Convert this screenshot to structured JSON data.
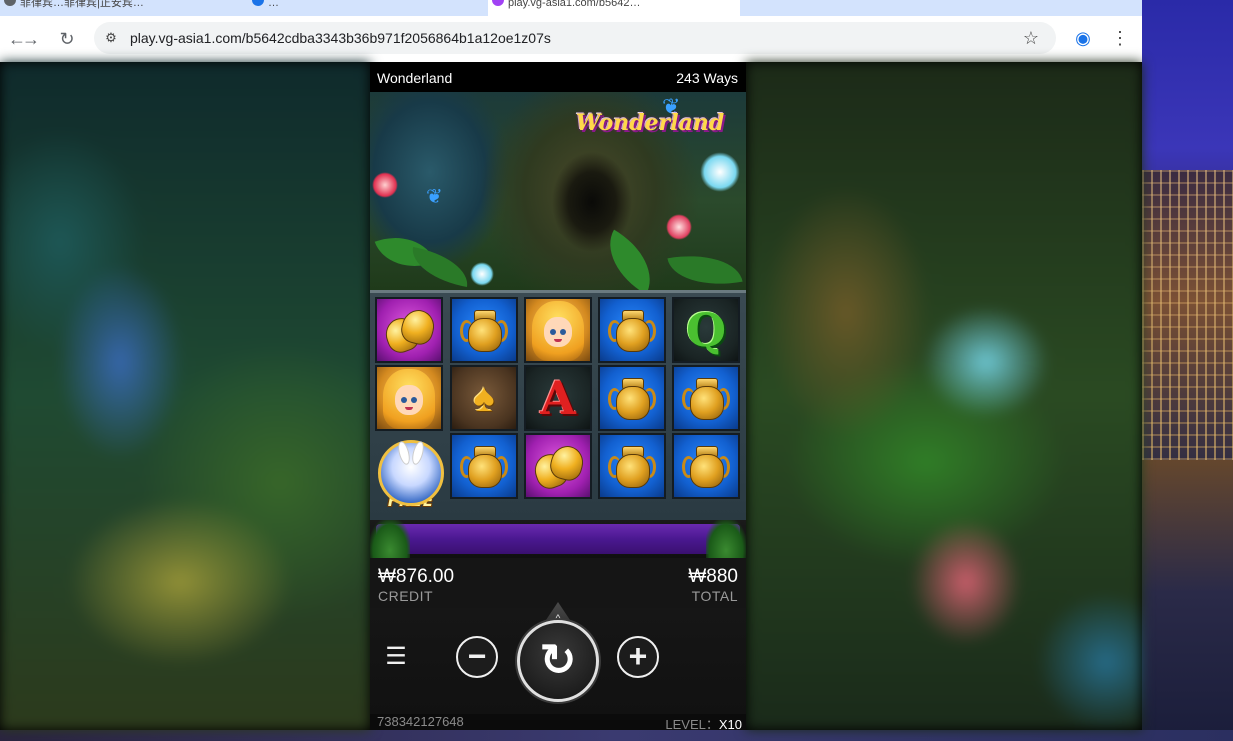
{
  "browser": {
    "tabs": [
      {
        "label": "菲律宾…菲律宾|正安宾…",
        "favicon_color": "#5f6368"
      },
      {
        "label": "…",
        "favicon_color": "#1a73e8"
      },
      {
        "label": "play.vg-asia1.com/b5642…",
        "favicon_color": "#a142f4"
      }
    ],
    "url": "play.vg-asia1.com/b5642cdba3343b36b971f2056864b1a12oe1z07s",
    "back_icon": "arrow-left-icon",
    "forward_icon": "arrow-right-icon",
    "reload_icon": "reload-icon",
    "tune_icon": "site-settings-icon",
    "star_icon": "bookmark-star-icon",
    "profile_icon": "profile-icon",
    "menu_icon": "kebab-menu-icon"
  },
  "game": {
    "title": "Wonderland",
    "ways": "243 Ways",
    "logo_text": "Wonderland",
    "reels": [
      [
        "bell",
        "alice",
        "free-rabbit"
      ],
      [
        "pot",
        "spade",
        "pot"
      ],
      [
        "alice",
        "A",
        "bell"
      ],
      [
        "pot",
        "pot",
        "pot"
      ],
      [
        "Q",
        "pot",
        "pot"
      ]
    ],
    "free_label": "FREE",
    "credit_value": "₩876.00",
    "credit_label": "CREDIT",
    "total_value": "₩880",
    "total_label": "TOTAL",
    "menu_glyph": "☰",
    "minus_glyph": "−",
    "plus_glyph": "+",
    "spin_glyph": "↻",
    "spin_up_glyph": "^",
    "session_id": "738342127648",
    "level_label": "LEVEL：",
    "level_value": "X10"
  }
}
